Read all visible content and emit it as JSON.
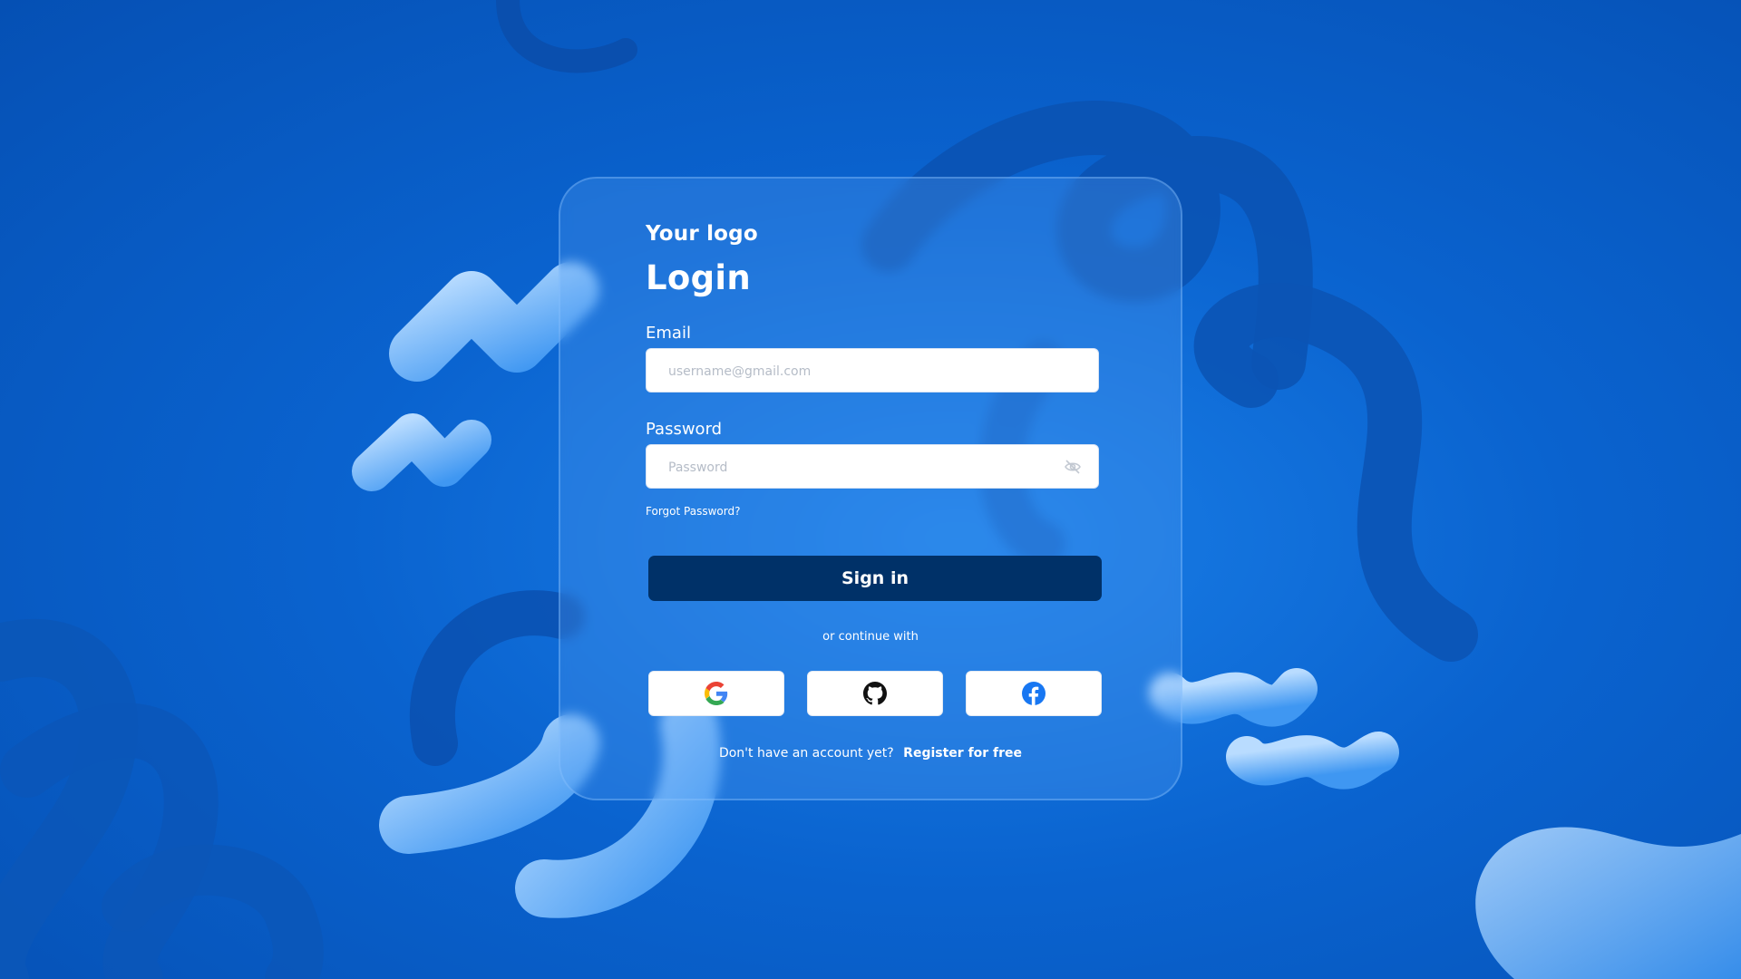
{
  "brand": {
    "logo_text": "Your logo",
    "accent": "#003168",
    "background": "#0a63cf"
  },
  "login": {
    "title": "Login",
    "email_label": "Email",
    "email_placeholder": "username@gmail.com",
    "email_value": "",
    "password_label": "Password",
    "password_placeholder": "Password",
    "password_value": "",
    "password_toggle_icon": "eye-off-icon",
    "forgot_link": "Forgot Password?",
    "signin_label": "Sign in",
    "divider_text": "or continue with",
    "social": [
      {
        "name": "Google",
        "icon": "google-icon"
      },
      {
        "name": "GitHub",
        "icon": "github-icon"
      },
      {
        "name": "Facebook",
        "icon": "facebook-icon"
      }
    ],
    "register_prompt": "Don't have an account yet?",
    "register_link": "Register for free"
  }
}
